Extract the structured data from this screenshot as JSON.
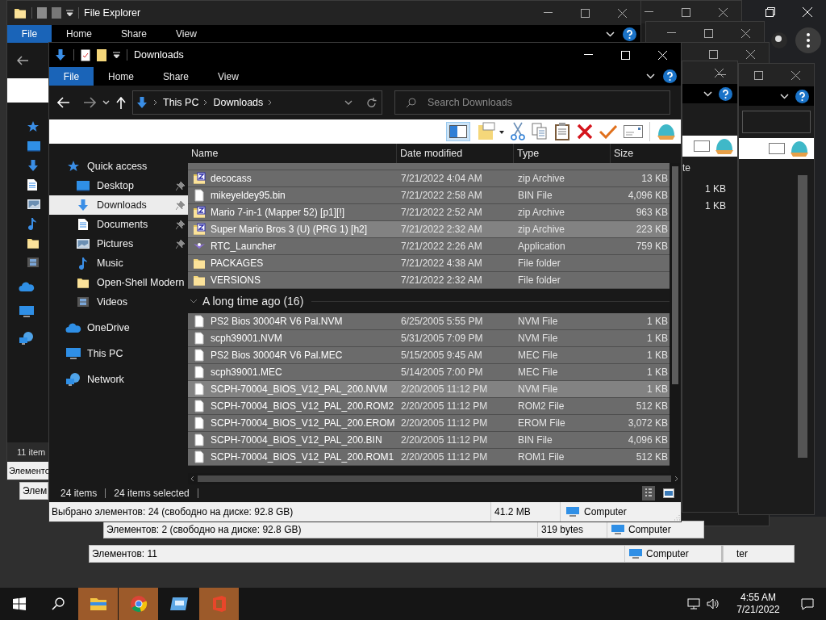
{
  "back_explorer": {
    "title": "File Explorer",
    "tabs": [
      {
        "label": "File",
        "selected": true
      },
      {
        "label": "Home",
        "selected": false
      },
      {
        "label": "Share",
        "selected": false
      },
      {
        "label": "View",
        "selected": false
      }
    ],
    "status": "11 item",
    "classic_status": "Элементо"
  },
  "window": {
    "title": "Downloads",
    "tabs": [
      {
        "label": "File",
        "selected": true
      },
      {
        "label": "Home",
        "selected": false
      },
      {
        "label": "Share",
        "selected": false
      },
      {
        "label": "View",
        "selected": false
      }
    ]
  },
  "address": {
    "path": [
      "This PC",
      "Downloads"
    ]
  },
  "search": {
    "placeholder": "Search Downloads"
  },
  "nav": [
    {
      "label": "Quick access",
      "kind": "star",
      "selected": false,
      "children": [
        {
          "label": "Desktop",
          "kind": "desktop",
          "pinned": true,
          "selected": false
        },
        {
          "label": "Downloads",
          "kind": "download",
          "pinned": true,
          "selected": true
        },
        {
          "label": "Documents",
          "kind": "document",
          "pinned": true,
          "selected": false
        },
        {
          "label": "Pictures",
          "kind": "picture",
          "pinned": true,
          "selected": false
        },
        {
          "label": "Music",
          "kind": "music",
          "pinned": false,
          "selected": false
        },
        {
          "label": "Open-Shell Modern",
          "kind": "folder",
          "pinned": false,
          "selected": false
        },
        {
          "label": "Videos",
          "kind": "video",
          "pinned": false,
          "selected": false
        }
      ]
    },
    {
      "label": "OneDrive",
      "kind": "cloud",
      "selected": false
    },
    {
      "label": "This PC",
      "kind": "pc",
      "selected": false
    },
    {
      "label": "Network",
      "kind": "network",
      "selected": false
    }
  ],
  "columns": [
    "Name",
    "Date modified",
    "Type",
    "Size"
  ],
  "groups": [
    {
      "rows": [
        {
          "name": "decocass",
          "date": "7/21/2022 4:04 AM",
          "type": "zip Archive",
          "size": "13 KB",
          "kind": "zip",
          "selected": true,
          "hot": false
        },
        {
          "name": "mikeyeldey95.bin",
          "date": "7/21/2022 2:58 AM",
          "type": "BIN File",
          "size": "4,096 KB",
          "kind": "file",
          "selected": true,
          "hot": false
        },
        {
          "name": "Mario 7-in-1 (Mapper 52) [p1][!]",
          "date": "7/21/2022 2:52 AM",
          "type": "zip Archive",
          "size": "963 KB",
          "kind": "zip",
          "selected": true,
          "hot": false
        },
        {
          "name": "Super Mario Bros 3 (U) (PRG 1) [h2]",
          "date": "7/21/2022 2:32 AM",
          "type": "zip Archive",
          "size": "223 KB",
          "kind": "zip",
          "selected": true,
          "hot": true
        },
        {
          "name": "RTC_Launcher",
          "date": "7/21/2022 2:26 AM",
          "type": "Application",
          "size": "759 KB",
          "kind": "app",
          "selected": true,
          "hot": false
        },
        {
          "name": "PACKAGES",
          "date": "7/21/2022 4:38 AM",
          "type": "File folder",
          "kind": "folder",
          "selected": true,
          "hot": false
        },
        {
          "name": "VERSIONS",
          "date": "7/21/2022 2:32 AM",
          "type": "File folder",
          "kind": "folder",
          "selected": true,
          "hot": false
        }
      ]
    },
    {
      "header": "A long time ago (16)",
      "expanded": true,
      "rows": [
        {
          "name": "PS2 Bios 30004R V6 Pal.NVM",
          "date": "6/25/2005 5:55 PM",
          "type": "NVM File",
          "size": "1 KB",
          "kind": "file",
          "selected": true,
          "hot": false
        },
        {
          "name": "scph39001.NVM",
          "date": "5/31/2005 7:09 PM",
          "type": "NVM File",
          "size": "1 KB",
          "kind": "file",
          "selected": true,
          "hot": false
        },
        {
          "name": "PS2 Bios 30004R V6 Pal.MEC",
          "date": "5/15/2005 9:45 AM",
          "type": "MEC File",
          "size": "1 KB",
          "kind": "file",
          "selected": true,
          "hot": false
        },
        {
          "name": "scph39001.MEC",
          "date": "5/14/2005 7:00 PM",
          "type": "MEC File",
          "size": "1 KB",
          "kind": "file",
          "selected": true,
          "hot": false
        },
        {
          "name": "SCPH-70004_BIOS_V12_PAL_200.NVM",
          "date": "2/20/2005 11:12 PM",
          "type": "NVM File",
          "size": "1 KB",
          "kind": "file",
          "selected": true,
          "hot": true
        },
        {
          "name": "SCPH-70004_BIOS_V12_PAL_200.ROM2",
          "date": "2/20/2005 11:12 PM",
          "type": "ROM2 File",
          "size": "512 KB",
          "kind": "file",
          "selected": true,
          "hot": false
        },
        {
          "name": "SCPH-70004_BIOS_V12_PAL_200.EROM",
          "date": "2/20/2005 11:12 PM",
          "type": "EROM File",
          "size": "3,072 KB",
          "kind": "file",
          "selected": true,
          "hot": false
        },
        {
          "name": "SCPH-70004_BIOS_V12_PAL_200.BIN",
          "date": "2/20/2005 11:12 PM",
          "type": "BIN File",
          "size": "4,096 KB",
          "kind": "file",
          "selected": true,
          "hot": false
        },
        {
          "name": "SCPH-70004_BIOS_V12_PAL_200.ROM1",
          "date": "2/20/2005 11:12 PM",
          "type": "ROM1 File",
          "size": "512 KB",
          "kind": "file",
          "selected": true,
          "hot": false
        }
      ]
    }
  ],
  "status": {
    "count": "24 items",
    "selection": "24 items selected"
  },
  "classic_status": {
    "text": "Выбрано элементов: 24 (свободно на диске: 92.8 GB)",
    "size": "41.2 MB",
    "location": "Computer"
  },
  "back_texts": {
    "column": "te",
    "sizes": [
      "1 KB",
      "1 KB"
    ]
  },
  "back_status_bars": [
    {
      "text": "Элем"
    },
    {
      "text": "Элементов: 2 (свободно на диске: 92.8 GB)",
      "size": "319 bytes",
      "location": "Computer"
    },
    {
      "text": "Элементов: 11",
      "location": "Computer"
    },
    {
      "location": "ter"
    }
  ],
  "taskbar": {
    "apps": [
      {
        "kind": "explorer",
        "open": true
      },
      {
        "kind": "chrome",
        "open": true
      },
      {
        "kind": "app",
        "open": false
      },
      {
        "kind": "office",
        "open": true
      }
    ],
    "time": "4:55 AM",
    "date": "7/21/2022"
  }
}
